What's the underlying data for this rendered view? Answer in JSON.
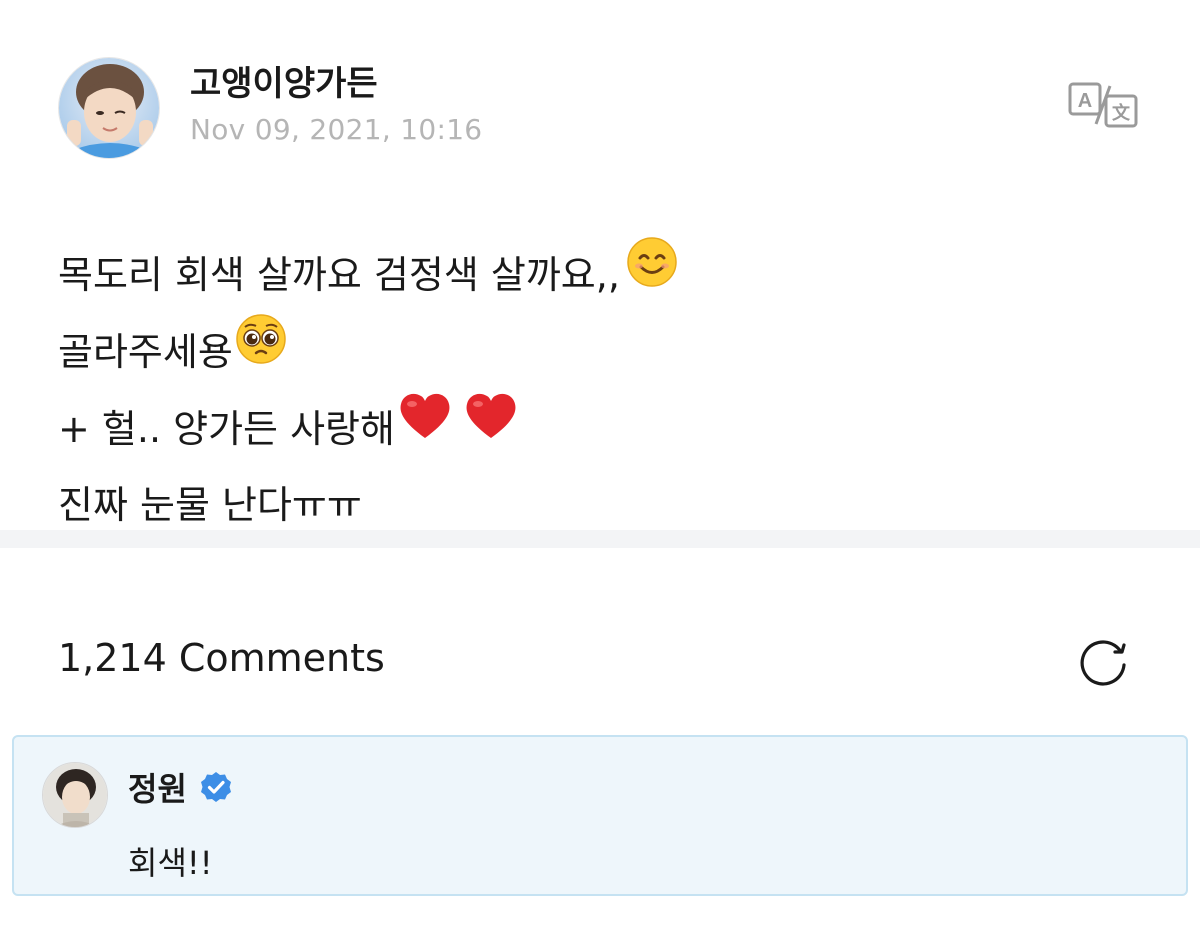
{
  "post": {
    "author": "고앵이양가든",
    "date": "Nov 09, 2021, 10:16",
    "lines": [
      "목도리 회색 살까요 검정색 살까요,,",
      "골라주세용",
      "+ 헐.. 양가든 사랑해",
      "진짜 눈물 난다ㅠㅠ"
    ],
    "translate_icon": "translate-icon",
    "avatar_icon": "user-avatar-photo"
  },
  "comments": {
    "header": "1,214 Comments",
    "refresh_icon": "refresh-icon",
    "items": [
      {
        "author": "정원",
        "verified": true,
        "text": "회색!!",
        "avatar_icon": "user-avatar-photo"
      }
    ]
  },
  "colors": {
    "comment_bg": "#eef6fb",
    "comment_border": "#c5e2f2",
    "verified_badge": "#3d8ee6",
    "date_text": "#b5b5b5",
    "heart": "#e3262c"
  }
}
